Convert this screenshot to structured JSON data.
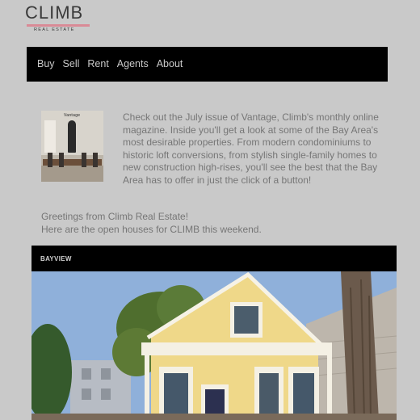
{
  "brand": {
    "name": "CLIMB",
    "tagline": "REAL ESTATE"
  },
  "nav": {
    "items": [
      "Buy",
      "Sell",
      "Rent",
      "Agents",
      "About"
    ]
  },
  "magazine": {
    "cover_title": "Vantage"
  },
  "intro_text": "Check out the July issue of Vantage, Climb's monthly online magazine. Inside you'll get a look at some of the Bay Area's most desirable properties. From modern condominiums to historic loft conversions, from stylish single-family homes to new construction high-rises, you'll see the best that the Bay Area has to offer in just the click of a button!",
  "greeting": {
    "line1": "Greetings from Climb Real Estate!",
    "line2": "Here are the open houses for CLIMB this weekend."
  },
  "listing": {
    "neighborhood": "BAYVIEW"
  },
  "colors": {
    "background": "#c9c9c9",
    "bar": "#000000",
    "logo_accent": "#d98a96",
    "house": "#efd889",
    "sky": "#8fb0da"
  }
}
